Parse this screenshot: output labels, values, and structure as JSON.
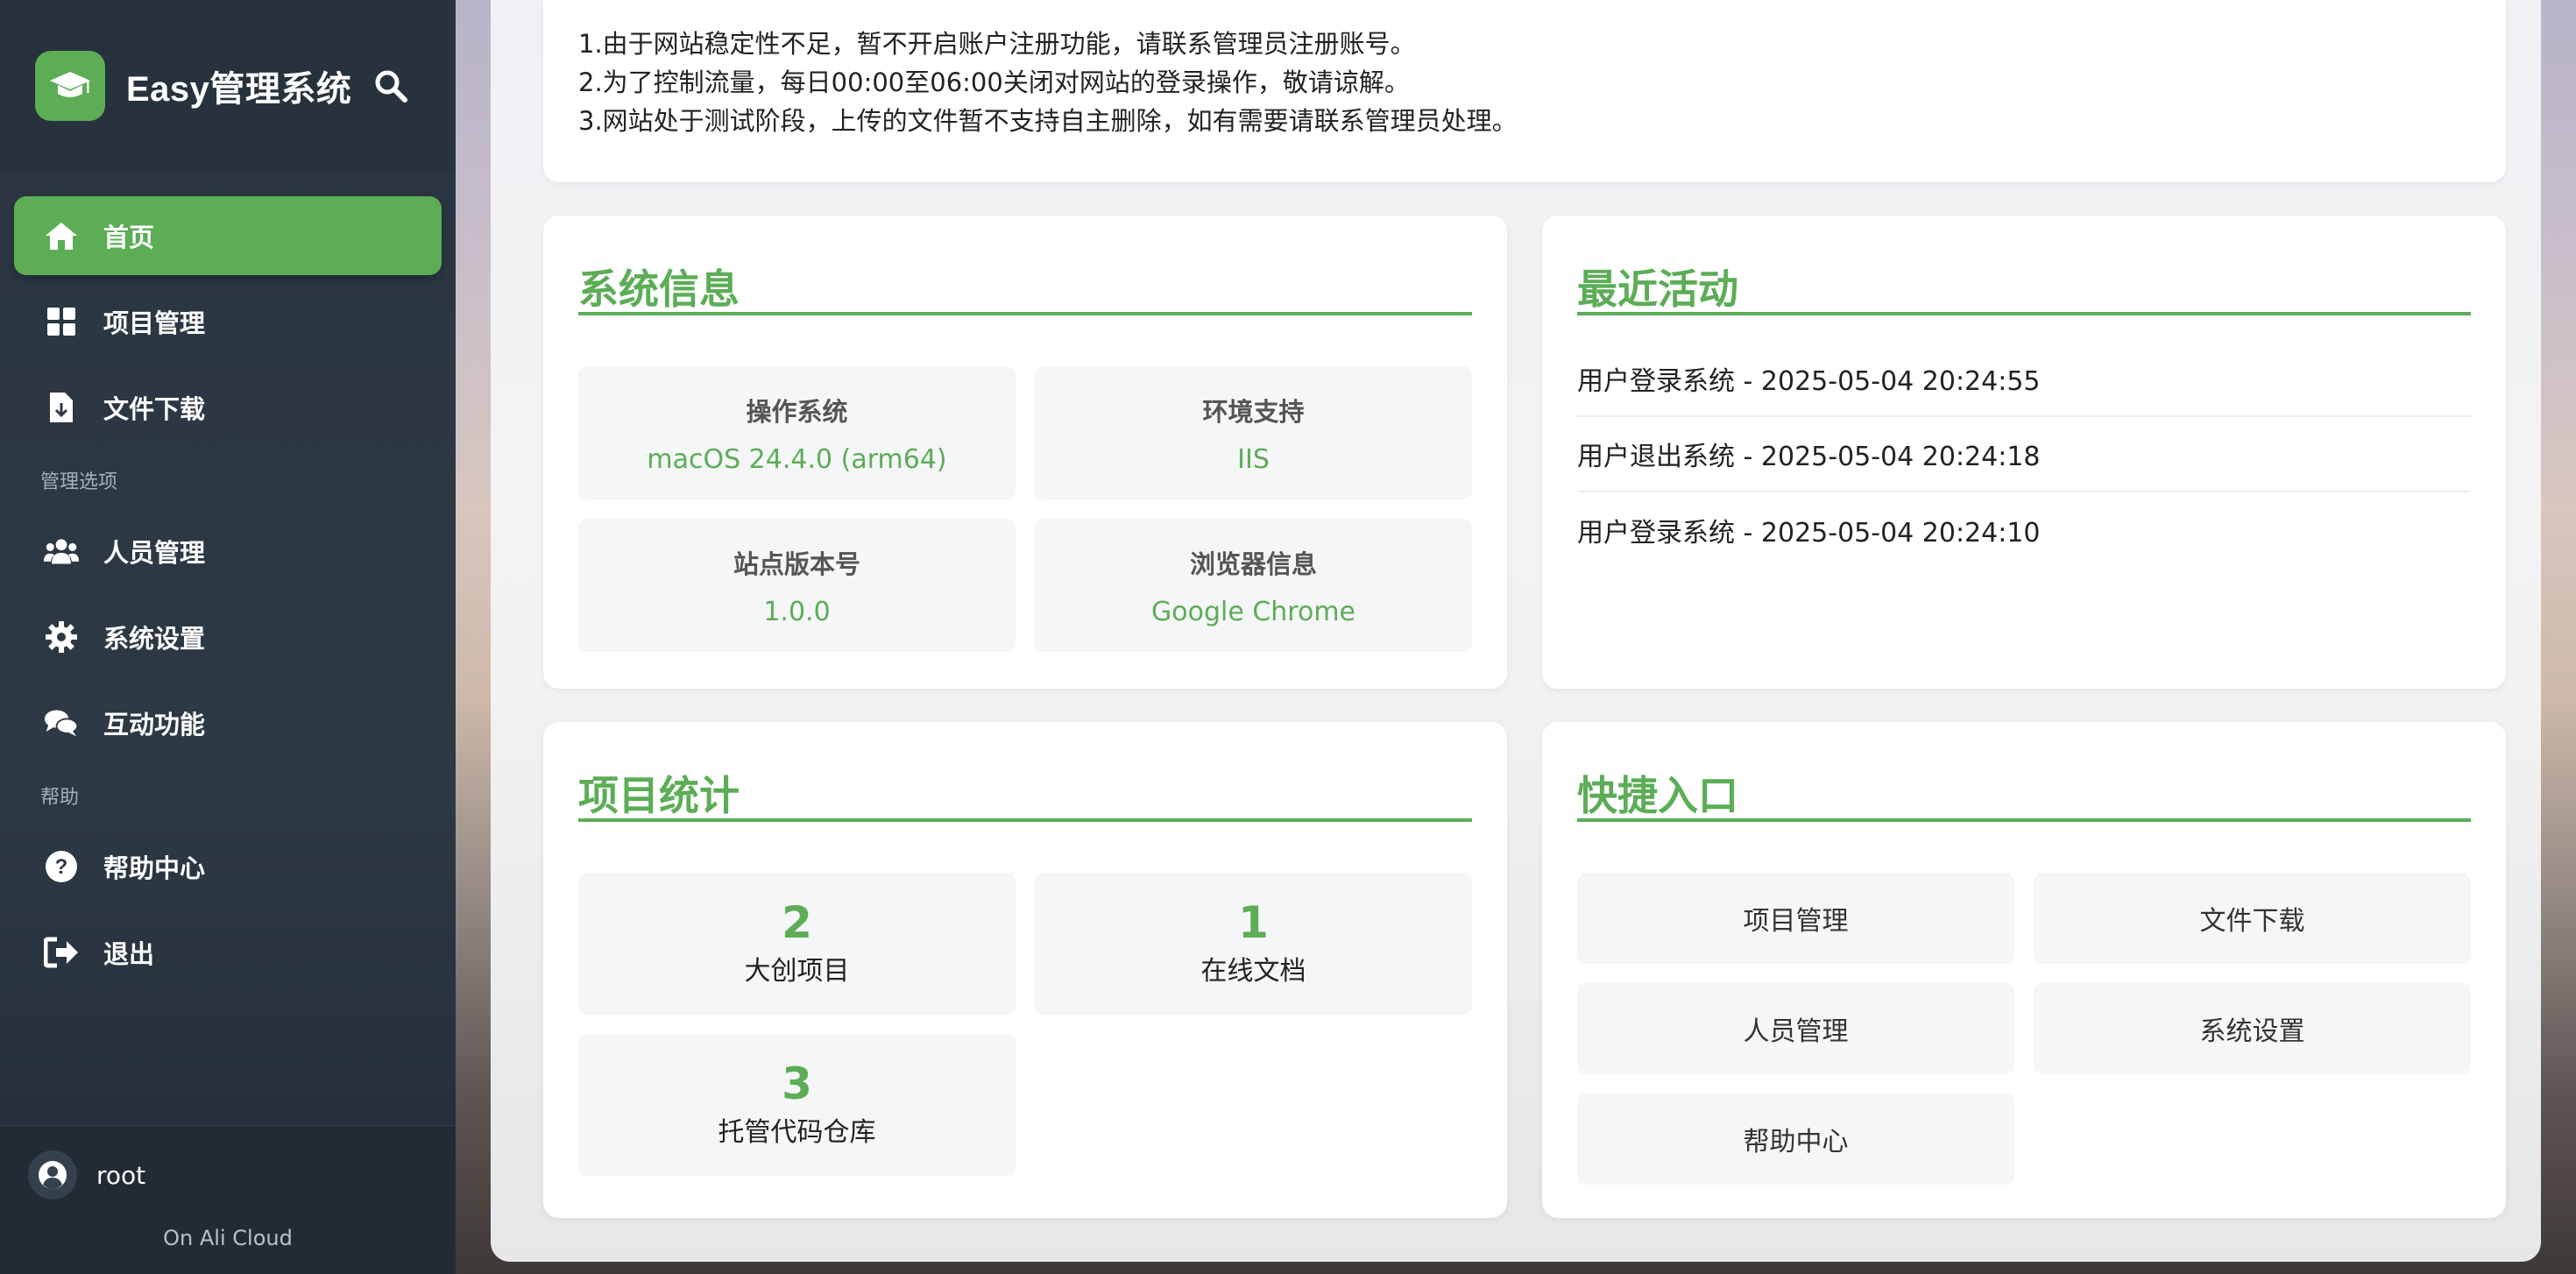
{
  "brand": {
    "title": "Easy管理系统"
  },
  "sidebar": {
    "items": [
      {
        "label": "首页",
        "icon": "home-icon",
        "active": true
      },
      {
        "label": "项目管理",
        "icon": "grid-icon"
      },
      {
        "label": "文件下载",
        "icon": "file-download-icon"
      }
    ],
    "section_manage": "管理选项",
    "manage_items": [
      {
        "label": "人员管理",
        "icon": "users-icon"
      },
      {
        "label": "系统设置",
        "icon": "gear-icon"
      },
      {
        "label": "互动功能",
        "icon": "comments-icon"
      }
    ],
    "section_help": "帮助",
    "help_items": [
      {
        "label": "帮助中心",
        "icon": "question-circle-icon"
      },
      {
        "label": "退出",
        "icon": "sign-out-icon"
      }
    ]
  },
  "user": {
    "name": "root",
    "host": "On Ali Cloud"
  },
  "notice": {
    "lines": [
      "1.由于网站稳定性不足，暂不开启账户注册功能，请联系管理员注册账号。",
      "2.为了控制流量，每日00:00至06:00关闭对网站的登录操作，敬请谅解。",
      "3.网站处于测试阶段，上传的文件暂不支持自主删除，如有需要请联系管理员处理。"
    ]
  },
  "system_info": {
    "title": "系统信息",
    "items": [
      {
        "label": "操作系统",
        "value": "macOS 24.4.0 (arm64)"
      },
      {
        "label": "环境支持",
        "value": "IIS"
      },
      {
        "label": "站点版本号",
        "value": "1.0.0"
      },
      {
        "label": "浏览器信息",
        "value": "Google Chrome"
      }
    ]
  },
  "recent": {
    "title": "最近活动",
    "items": [
      "用户登录系统 - 2025-05-04 20:24:55",
      "用户退出系统 - 2025-05-04 20:24:18",
      "用户登录系统 - 2025-05-04 20:24:10"
    ]
  },
  "stats": {
    "title": "项目统计",
    "items": [
      {
        "value": "2",
        "label": "大创项目"
      },
      {
        "value": "1",
        "label": "在线文档"
      },
      {
        "value": "3",
        "label": "托管代码仓库"
      }
    ]
  },
  "quick": {
    "title": "快捷入口",
    "items": [
      "项目管理",
      "文件下载",
      "人员管理",
      "系统设置",
      "帮助中心"
    ]
  },
  "colors": {
    "accent": "#5cad56",
    "sidebar": "#2d3945"
  }
}
